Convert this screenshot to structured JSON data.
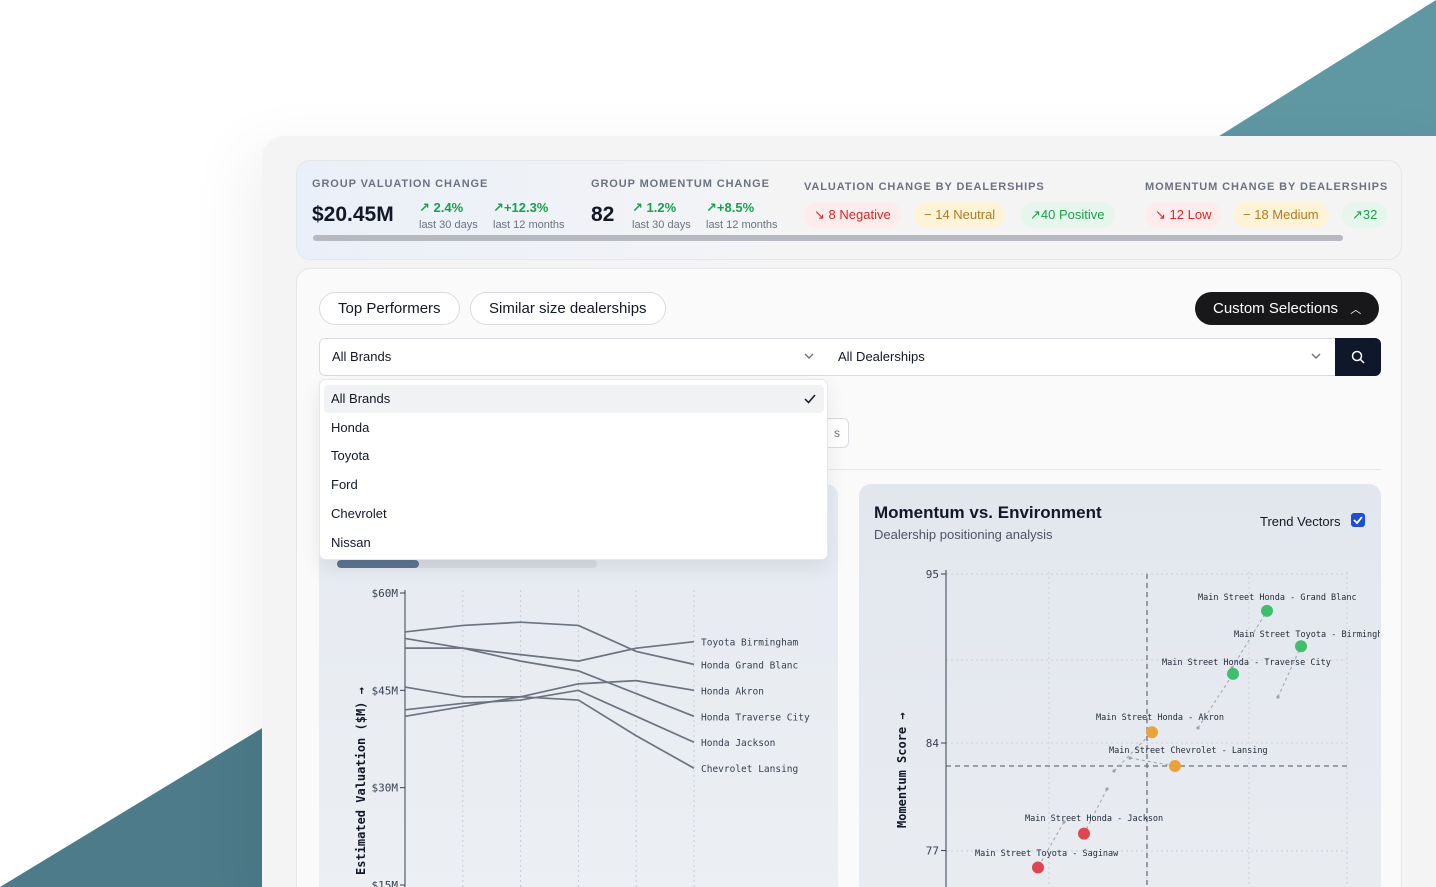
{
  "kpi": {
    "valuation": {
      "label": "GROUP VALUATION CHANGE",
      "value": "$20.45M",
      "d30": "2.4%",
      "d30_sub": "last 30 days",
      "d12": "+12.3%",
      "d12_sub": "last 12 months"
    },
    "momentum": {
      "label": "GROUP MOMENTUM CHANGE",
      "value": "82",
      "d30": "1.2%",
      "d30_sub": "last 30 days",
      "d12": "+8.5%",
      "d12_sub": "last 12 months"
    },
    "val_by_dealer": {
      "label": "VALUATION CHANGE BY DEALERSHIPS",
      "negative": "8 Negative",
      "neutral": "14 Neutral",
      "positive": "40 Positive"
    },
    "mom_by_dealer": {
      "label": "MOMENTUM CHANGE BY DEALERSHIPS",
      "low": "12 Low",
      "medium": "18 Medium",
      "high": "32"
    },
    "colors": {
      "positive": "#16a34a",
      "negative": "#dc2626",
      "neutral": "#b7791f"
    }
  },
  "filters": {
    "top_performers": "Top Performers",
    "similar_size": "Similar size dealerships",
    "custom": "Custom Selections",
    "brand_select": "All Brands",
    "dealer_select": "All Dealerships",
    "hidden_chip_text": "s"
  },
  "dropdown": {
    "items": [
      {
        "label": "All Brands",
        "selected": true
      },
      {
        "label": "Honda",
        "selected": false
      },
      {
        "label": "Toyota",
        "selected": false
      },
      {
        "label": "Ford",
        "selected": false
      },
      {
        "label": "Chevrolet",
        "selected": false
      },
      {
        "label": "Nissan",
        "selected": false
      }
    ]
  },
  "left_chart": {
    "ylabel": "Estimated Valuation ($M) →"
  },
  "right_chart": {
    "title": "Momentum vs. Environment",
    "subtitle": "Dealership positioning analysis",
    "trend_vectors_label": "Trend Vectors",
    "trend_vectors_checked": true,
    "ylabel": "Momentum Score →"
  },
  "chart_data": [
    {
      "type": "line",
      "ylabel": "Estimated Valuation ($M) →",
      "yticks": [
        "$60M",
        "$45M",
        "$30M",
        "$15M"
      ],
      "ylim": [
        15,
        60
      ],
      "x": [
        0,
        1,
        2,
        3,
        4,
        5
      ],
      "series": [
        {
          "name": "Toyota Birmingham",
          "values": [
            51.5,
            51.5,
            50.5,
            49.5,
            51.5,
            52.5
          ]
        },
        {
          "name": "Honda Grand Blanc",
          "values": [
            54,
            55,
            55.5,
            55,
            51,
            49
          ]
        },
        {
          "name": "Honda Akron",
          "values": [
            41,
            42.5,
            44,
            46,
            46.5,
            45
          ]
        },
        {
          "name": "Honda Traverse City",
          "values": [
            53,
            51.5,
            49.5,
            48,
            44.5,
            41
          ]
        },
        {
          "name": "Chevrolet Lansing",
          "values": [
            45.5,
            44,
            44,
            43.5,
            38,
            33
          ]
        },
        {
          "name": "Honda Jackson",
          "values": [
            42,
            43,
            43.5,
            45,
            41,
            37
          ]
        }
      ]
    },
    {
      "type": "scatter",
      "title": "Momentum vs. Environment",
      "ylabel": "Momentum Score →",
      "yticks": [
        95,
        84,
        77
      ],
      "points": [
        {
          "name": "Main Street Honda - Grand Blanc",
          "y": 92.6,
          "status": "green"
        },
        {
          "name": "Main Street Toyota - Birmingham",
          "y": 90.3,
          "status": "green"
        },
        {
          "name": "Main Street Honda - Traverse City",
          "y": 88.5,
          "status": "green"
        },
        {
          "name": "Main Street Honda - Akron",
          "y": 84.7,
          "status": "orange"
        },
        {
          "name": "Main Street Chevrolet - Lansing",
          "y": 82.5,
          "status": "orange"
        },
        {
          "name": "Main Street Honda - Jackson",
          "y": 78.1,
          "status": "red"
        },
        {
          "name": "Main Street Toyota - Saginaw",
          "y": 75.9,
          "status": "red"
        }
      ],
      "colors": {
        "green": "#3fbf6d",
        "orange": "#e8a33a",
        "red": "#e0464f"
      }
    }
  ]
}
